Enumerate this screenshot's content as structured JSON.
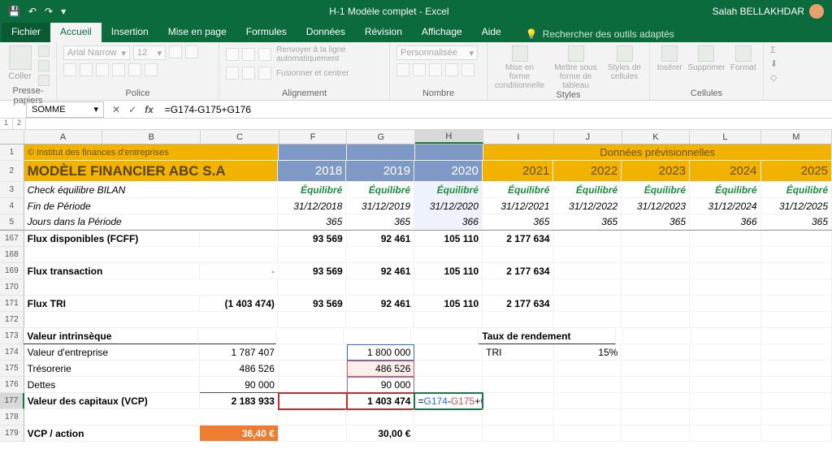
{
  "app": {
    "title": "H-1 Modèle complet  -  Excel",
    "user": "Salah BELLAKHDAR"
  },
  "tabs": {
    "file": "Fichier",
    "home": "Accueil",
    "insert": "Insertion",
    "layout": "Mise en page",
    "formulas": "Formules",
    "data": "Données",
    "review": "Révision",
    "view": "Affichage",
    "help": "Aide",
    "tellme": "Rechercher des outils adaptés"
  },
  "ribbon": {
    "paste": "Coller",
    "clipboard": "Presse-papiers",
    "fontname": "Arial Narrow",
    "fontsize": "12",
    "fontgroup": "Police",
    "wrap": "Renvoyer à la ligne automatiquement",
    "merge": "Fusionner et centrer",
    "aligngroup": "Alignement",
    "numfmt": "Personnalisée",
    "numgroup": "Nombre",
    "condfmt": "Mise en forme conditionnelle",
    "table": "Mettre sous forme de tableau",
    "cellstyles": "Styles de cellules",
    "stylesgroup": "Styles",
    "insertc": "Insérer",
    "deletec": "Supprimer",
    "formatc": "Format",
    "cellsgroup": "Cellules"
  },
  "fx": {
    "namebox": "SOMME",
    "formula": "=G174-G175+G176",
    "ref1": "G174",
    "ref2": "G175",
    "ref3": "G176"
  },
  "cols": {
    "A": "A",
    "B": "B",
    "C": "C",
    "F": "F",
    "G": "G",
    "H": "H",
    "I": "I",
    "J": "J",
    "K": "K",
    "L": "L",
    "M": "M"
  },
  "sheet": {
    "copyright": "© Institut des finances d'entreprises",
    "title": "MODÈLE FINANCIER ABC S.A",
    "forecast_header": "Données prévisionnelles",
    "years": {
      "F": "2018",
      "G": "2019",
      "H": "2020",
      "I": "2021",
      "J": "2022",
      "K": "2023",
      "L": "2024",
      "M": "2025"
    },
    "row3_label": "Check équilibre BILAN",
    "equil": "Équilibré",
    "row4_label": "Fin de Période",
    "dates": {
      "F": "31/12/2018",
      "G": "31/12/2019",
      "H": "31/12/2020",
      "I": "31/12/2021",
      "J": "31/12/2022",
      "K": "31/12/2023",
      "L": "31/12/2024",
      "M": "31/12/2025"
    },
    "row5_label": "Jours dans la Période",
    "days": {
      "F": "365",
      "G": "365",
      "H": "366",
      "I": "365",
      "J": "365",
      "K": "365",
      "L": "366",
      "M": "365"
    },
    "r167_label": "Flux disponibles (FCFF)",
    "r167": {
      "F": "93 569",
      "G": "92 461",
      "H": "105 110",
      "I": "2 177 634"
    },
    "r169_label": "Flux transaction",
    "r169_dash": "-",
    "r169": {
      "F": "93 569",
      "G": "92 461",
      "H": "105 110",
      "I": "2 177 634"
    },
    "r171_label": "Flux TRI",
    "r171_C": "(1 403 474)",
    "r171": {
      "F": "93 569",
      "G": "92 461",
      "H": "105 110",
      "I": "2 177 634"
    },
    "r173_label": "Valeur intrinsèque",
    "r173_right": "Taux de rendement",
    "r174_label": "Valeur d'entreprise",
    "r174_C": "1 787 407",
    "r174_G": "1 800 000",
    "r174_I": "TRI",
    "r174_J": "15%",
    "r175_label": "Trésorerie",
    "r175_C": "486 526",
    "r175_G": "486 526",
    "r176_label": "Dettes",
    "r176_C": "90 000",
    "r176_G": "90 000",
    "r177_label": "Valeur des capitaux (VCP)",
    "r177_C": "2 183 933",
    "r177_G": "1 403 474",
    "r177_H": "=G174-G175+G176",
    "r179_label": "VCP / action",
    "r179_C": "36,40 €",
    "r179_G": "30,00 €"
  }
}
